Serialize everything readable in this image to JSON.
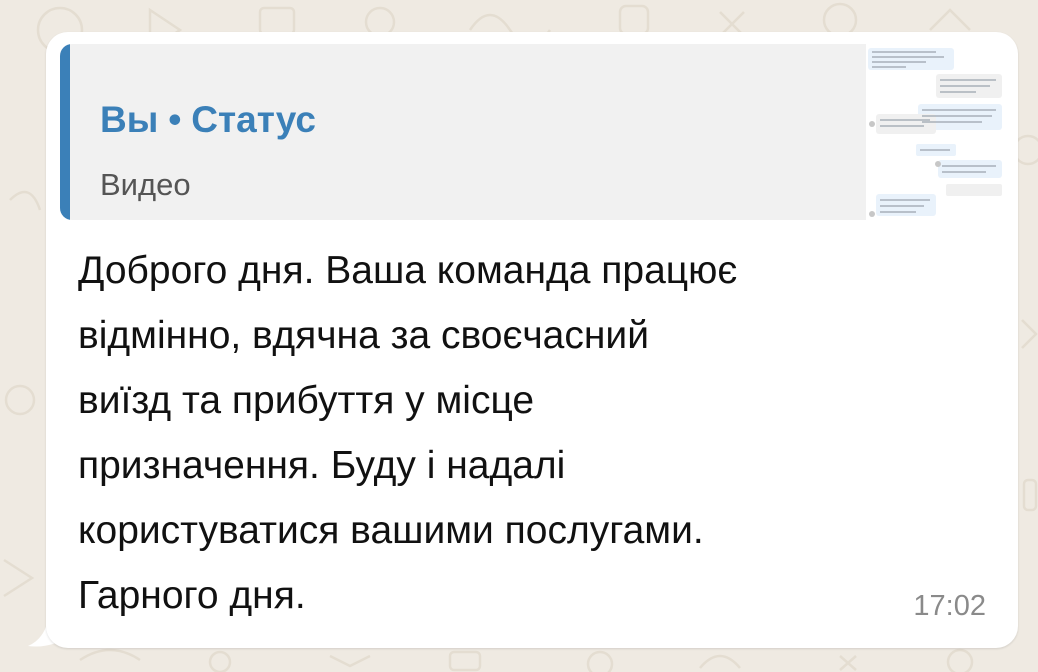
{
  "colors": {
    "wallpaper": "#efeae2",
    "bubble": "#ffffff",
    "quote_background": "#f1f1f1",
    "quote_accent": "#3b80b8",
    "message_text": "#111111",
    "time_text": "#8a8a8a"
  },
  "quote": {
    "author": "Вы",
    "separator": "•",
    "source": "Статус",
    "media_type": "Видео",
    "thumbnail": "chat-screenshot-thumbnail"
  },
  "message": {
    "lines": [
      "Доброго дня. Ваша команда працює",
      "відмінно, вдячна за своєчасний",
      "виїзд та прибуття у місце",
      "призначення. Буду і надалі",
      "користуватися вашими послугами.",
      "Гарного дня."
    ],
    "time": "17:02"
  }
}
